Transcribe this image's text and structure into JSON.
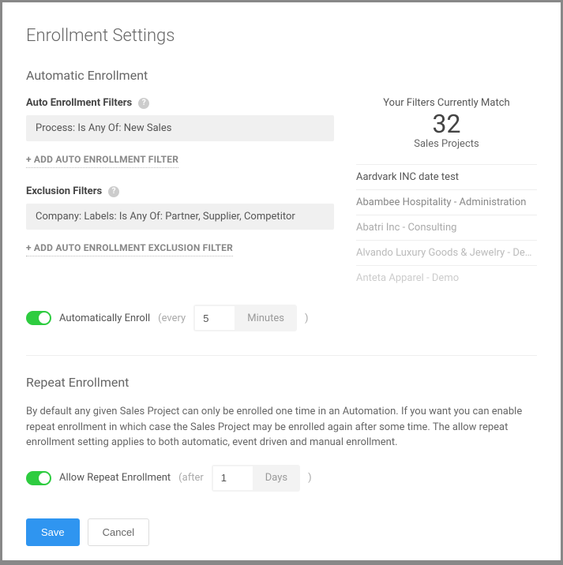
{
  "title": "Enrollment Settings",
  "automatic": {
    "heading": "Automatic Enrollment",
    "auto_filters_label": "Auto Enrollment Filters",
    "auto_filter_chip": "Process: Is Any Of: New Sales",
    "add_auto_filter": "+ ADD AUTO ENROLLMENT FILTER",
    "exclusion_filters_label": "Exclusion Filters",
    "exclusion_chip": "Company: Labels: Is Any Of: Partner, Supplier, Competitor",
    "add_exclusion_filter": "+ ADD AUTO ENROLLMENT EXCLUSION FILTER",
    "match_header": "Your Filters Currently Match",
    "match_count": "32",
    "match_sub": "Sales Projects",
    "matches": [
      "Aardvark INC date test",
      "Abambee Hospitality - Administration",
      "Abatri Inc - Consulting",
      "Alvando Luxury Goods & Jewelry - De…",
      "Anteta Apparel - Demo"
    ],
    "enroll_toggle_label": "Automatically Enroll",
    "every_prefix": "(every",
    "interval_value": "5",
    "interval_unit": "Minutes",
    "paren_close": ")"
  },
  "repeat": {
    "heading": "Repeat Enrollment",
    "description": "By default any given Sales Project can only be enrolled one time in an Automation. If you want you can enable repeat enrollment in which case the Sales Project may be enrolled again after some time. The allow repeat enrollment setting applies to both automatic, event driven and manual enrollment.",
    "toggle_label": "Allow Repeat Enrollment",
    "after_prefix": "(after",
    "interval_value": "1",
    "interval_unit": "Days",
    "paren_close": ")"
  },
  "buttons": {
    "save": "Save",
    "cancel": "Cancel"
  }
}
